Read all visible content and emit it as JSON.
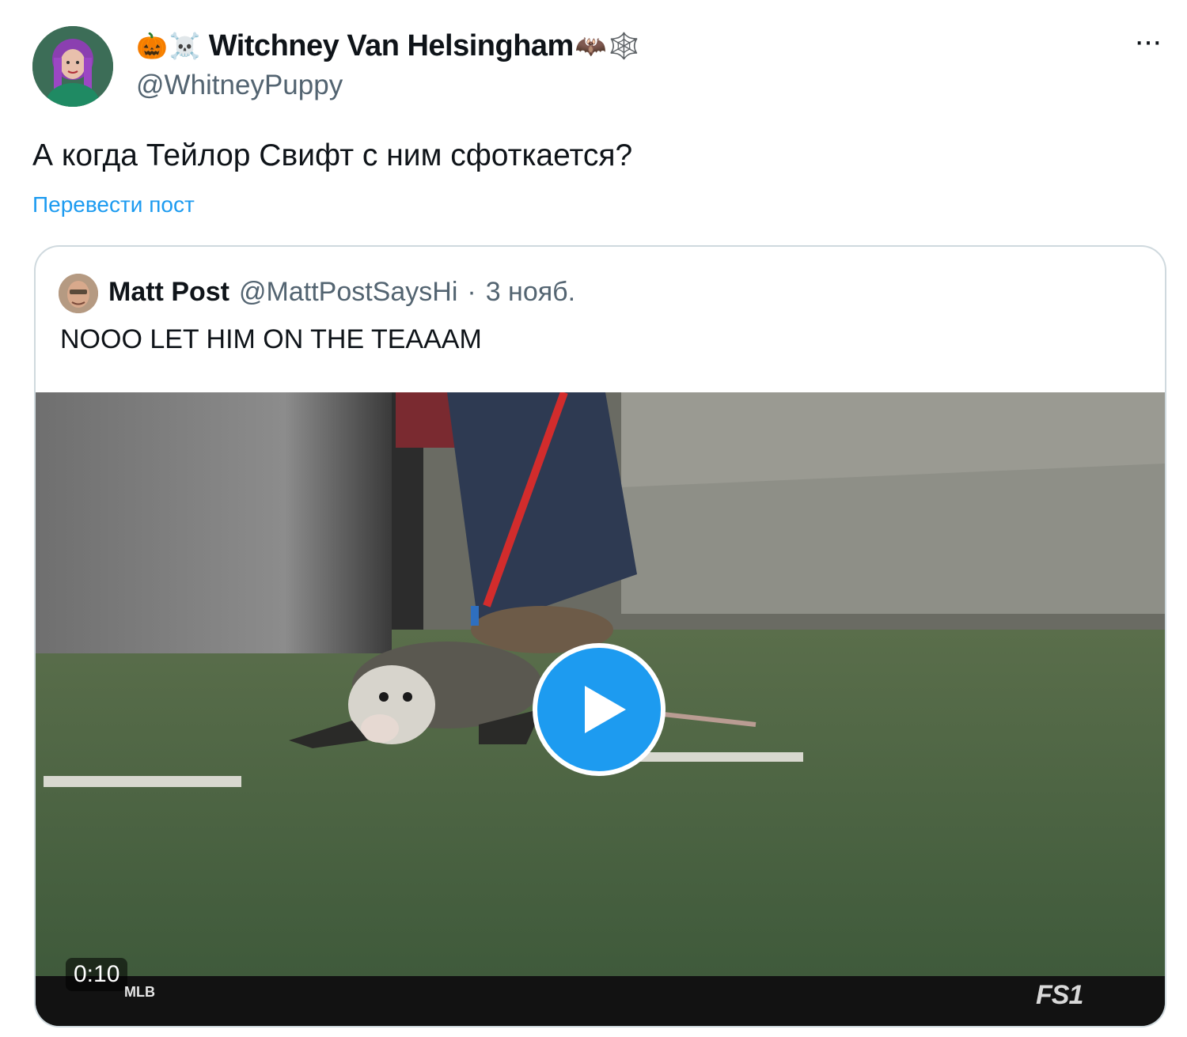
{
  "post": {
    "author": {
      "emoji_prefix": [
        "🎃",
        "☠️"
      ],
      "display_name": "Witchney Van Helsingham",
      "emoji_suffix": [
        "🦇",
        "🕸️"
      ],
      "handle": "@WhitneyPuppy",
      "avatar_icon": "profile-photo"
    },
    "more_icon": "···",
    "text": "А когда Тейлор Свифт с ним сфоткается?",
    "translate_label": "Перевести пост"
  },
  "quoted": {
    "author_name": "Matt Post",
    "handle": "@MattPostSaysHi",
    "separator": "·",
    "date": "3 нояб.",
    "text": "NOOO LET HIM ON THE TEAAAM",
    "video": {
      "duration": "0:10",
      "broadcast_left_logo": "MLB",
      "broadcast_right_logo": "FS1",
      "play_icon": "play-icon"
    }
  },
  "colors": {
    "link": "#1d9bf0",
    "secondary_text": "#536471",
    "card_border": "#cfd9de",
    "play_button": "#1d9bf0"
  }
}
